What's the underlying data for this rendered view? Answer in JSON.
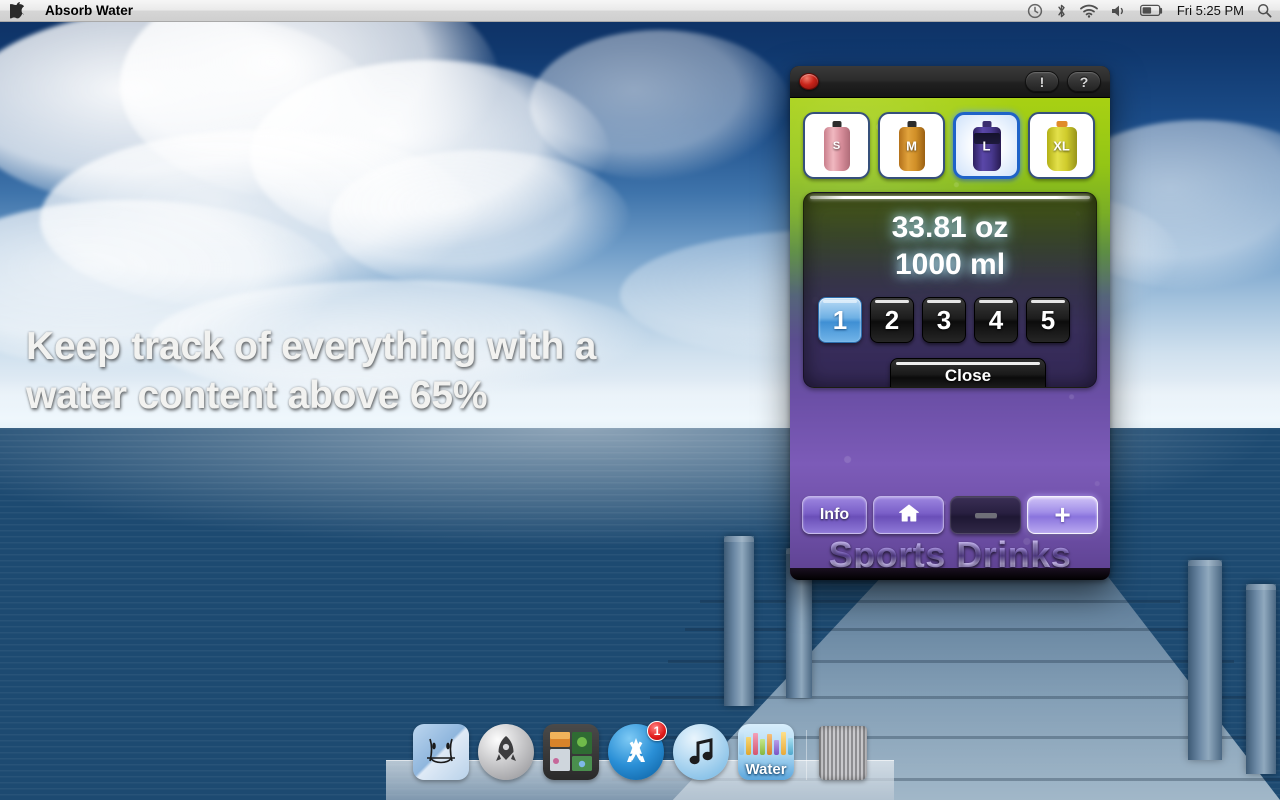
{
  "menubar": {
    "apple_icon": "apple-logo",
    "app_title": "Absorb Water",
    "status_icons": [
      "time-machine-icon",
      "bluetooth-icon",
      "wifi-icon",
      "volume-icon",
      "battery-icon"
    ],
    "clock": "Fri 5:25 PM",
    "spotlight_icon": "search-icon"
  },
  "desktop": {
    "tagline_line1": "Keep track of everything with a",
    "tagline_line2": "water content above 65%"
  },
  "widget": {
    "titlebar": {
      "close_label": "",
      "alert_label": "!",
      "help_label": "?"
    },
    "sizes": [
      {
        "label": "S",
        "name": "bottle-size-s",
        "selected": false
      },
      {
        "label": "M",
        "name": "bottle-size-m",
        "selected": false
      },
      {
        "label": "L",
        "name": "bottle-size-l",
        "selected": true
      },
      {
        "label": "XL",
        "name": "bottle-size-xl",
        "selected": false
      }
    ],
    "readout": {
      "ounces": "33.81 oz",
      "milliliters": "1000 ml"
    },
    "quantities": [
      {
        "label": "1",
        "selected": true
      },
      {
        "label": "2",
        "selected": false
      },
      {
        "label": "3",
        "selected": false
      },
      {
        "label": "4",
        "selected": false
      },
      {
        "label": "5",
        "selected": false
      }
    ],
    "close_button": "Close",
    "toolbar": {
      "info_label": "Info",
      "home_label": "home-icon",
      "minus_label": "minus-icon",
      "plus_label": "+"
    },
    "brand": "Sports Drinks"
  },
  "dock": {
    "items": [
      {
        "name": "dock-item-finder",
        "label": "Finder",
        "badge": ""
      },
      {
        "name": "dock-item-launchpad",
        "label": "Launchpad",
        "badge": ""
      },
      {
        "name": "dock-item-mission-control",
        "label": "Mission Control",
        "badge": ""
      },
      {
        "name": "dock-item-app-store",
        "label": "App Store",
        "badge": "1"
      },
      {
        "name": "dock-item-itunes",
        "label": "iTunes",
        "badge": ""
      },
      {
        "name": "dock-item-water",
        "label": "Water",
        "badge": ""
      },
      {
        "name": "dock-item-trash",
        "label": "Trash",
        "badge": ""
      }
    ],
    "water_app_word": "Water"
  },
  "colors": {
    "accent_blue": "#3f8fd4",
    "widget_green": "#a8d113",
    "widget_purple": "#6b4fa6",
    "badge_red": "#e01a1a"
  }
}
